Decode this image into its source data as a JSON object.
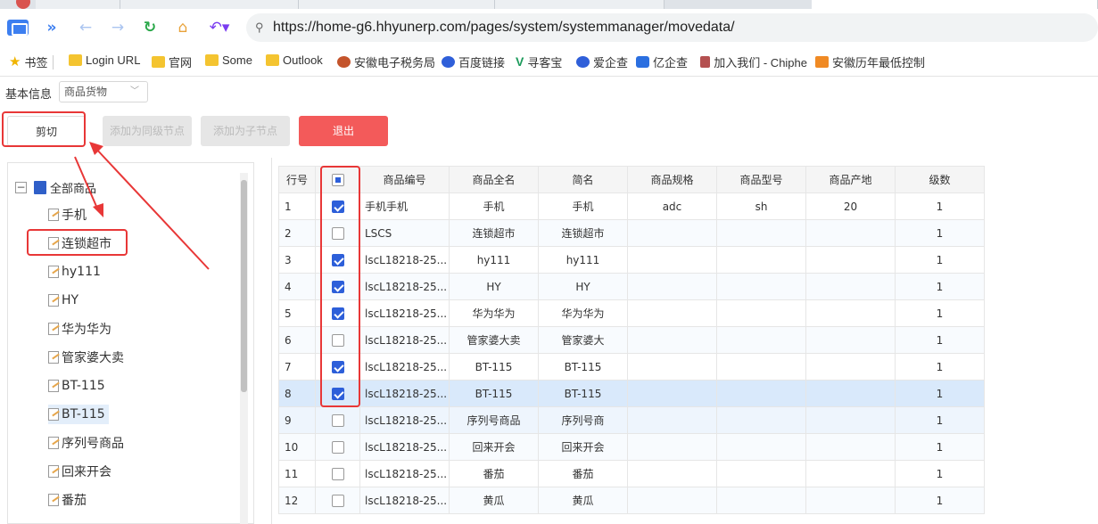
{
  "browser": {
    "url": "https://home-g6.hhyunerp.com/pages/system/systemmanager/movedata/",
    "bookmarks": [
      {
        "label": "书签",
        "icon": "star-icon"
      },
      {
        "label": "Login URL",
        "icon": "folder-icon"
      },
      {
        "label": "官网",
        "icon": "folder-icon"
      },
      {
        "label": "Some",
        "icon": "folder-icon"
      },
      {
        "label": "Outlook",
        "icon": "folder-icon"
      },
      {
        "label": "安徽电子税务局",
        "icon": "tax-icon"
      },
      {
        "label": "百度链接",
        "icon": "baidu-icon"
      },
      {
        "label": "寻客宝",
        "icon": "v-icon"
      },
      {
        "label": "爱企查",
        "icon": "baidu-icon"
      },
      {
        "label": "亿企查",
        "icon": "at-icon"
      },
      {
        "label": "加入我们 - Chiphe",
        "icon": "chip-icon"
      },
      {
        "label": "安徽历年最低控制",
        "icon": "orange-icon"
      }
    ]
  },
  "toolbar": {
    "basic_label": "基本信息",
    "select_value": "商品货物",
    "cut_label": "剪切",
    "add_sibling_label": "添加为同级节点",
    "add_child_label": "添加为子节点",
    "exit_label": "退出",
    "colors": {
      "exit": "#f35a5a",
      "annotation": "#e83737",
      "checkbox": "#2d5fd9"
    }
  },
  "tree": {
    "root_label": "全部商品",
    "nodes": [
      {
        "label": "手机"
      },
      {
        "label": "连锁超市"
      },
      {
        "label": "hy111"
      },
      {
        "label": "HY"
      },
      {
        "label": "华为华为"
      },
      {
        "label": "管家婆大卖"
      },
      {
        "label": "BT-115"
      },
      {
        "label": "BT-115"
      },
      {
        "label": "序列号商品"
      },
      {
        "label": "回来开会"
      },
      {
        "label": "番茄"
      }
    ]
  },
  "grid": {
    "headers": [
      "行号",
      "",
      "商品编号",
      "商品全名",
      "简名",
      "商品规格",
      "商品型号",
      "商品产地",
      "级数"
    ],
    "rows": [
      {
        "no": "1",
        "checked": true,
        "code": "手机手机",
        "name": "手机",
        "short": "手机",
        "spec": "adc",
        "model": "sh",
        "origin": "20",
        "level": "1"
      },
      {
        "no": "2",
        "checked": false,
        "code": "LSCS",
        "name": "连锁超市",
        "short": "连锁超市",
        "spec": "",
        "model": "",
        "origin": "",
        "level": "1"
      },
      {
        "no": "3",
        "checked": true,
        "code": "lscL18218-25...",
        "name": "hy111",
        "short": "hy111",
        "spec": "",
        "model": "",
        "origin": "",
        "level": "1"
      },
      {
        "no": "4",
        "checked": true,
        "code": "lscL18218-25...",
        "name": "HY",
        "short": "HY",
        "spec": "",
        "model": "",
        "origin": "",
        "level": "1"
      },
      {
        "no": "5",
        "checked": true,
        "code": "lscL18218-25...",
        "name": "华为华为",
        "short": "华为华为",
        "spec": "",
        "model": "",
        "origin": "",
        "level": "1"
      },
      {
        "no": "6",
        "checked": false,
        "code": "lscL18218-25...",
        "name": "管家婆大卖",
        "short": "管家婆大",
        "spec": "",
        "model": "",
        "origin": "",
        "level": "1"
      },
      {
        "no": "7",
        "checked": true,
        "code": "lscL18218-25...",
        "name": "BT-115",
        "short": "BT-115",
        "spec": "",
        "model": "",
        "origin": "",
        "level": "1"
      },
      {
        "no": "8",
        "checked": true,
        "code": "lscL18218-25...",
        "name": "BT-115",
        "short": "BT-115",
        "spec": "",
        "model": "",
        "origin": "",
        "level": "1"
      },
      {
        "no": "9",
        "checked": false,
        "code": "lscL18218-25...",
        "name": "序列号商品",
        "short": "序列号商",
        "spec": "",
        "model": "",
        "origin": "",
        "level": "1"
      },
      {
        "no": "10",
        "checked": false,
        "code": "lscL18218-25...",
        "name": "回来开会",
        "short": "回来开会",
        "spec": "",
        "model": "",
        "origin": "",
        "level": "1"
      },
      {
        "no": "11",
        "checked": false,
        "code": "lscL18218-25...",
        "name": "番茄",
        "short": "番茄",
        "spec": "",
        "model": "",
        "origin": "",
        "level": "1"
      },
      {
        "no": "12",
        "checked": false,
        "code": "lscL18218-25...",
        "name": "黄瓜",
        "short": "黄瓜",
        "spec": "",
        "model": "",
        "origin": "",
        "level": "1"
      }
    ]
  }
}
